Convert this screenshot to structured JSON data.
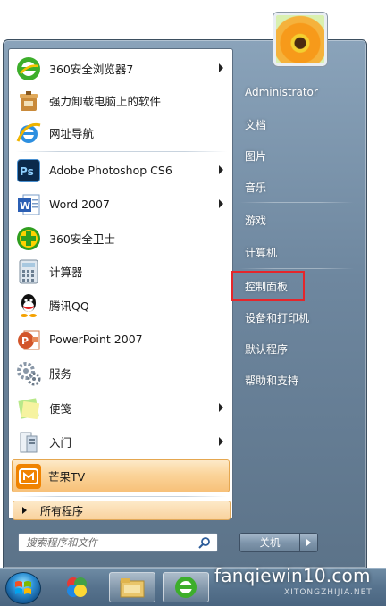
{
  "left_programs": [
    {
      "label": "360安全浏览器7",
      "icon": "360-browser-icon",
      "submenu": true
    },
    {
      "label": "强力卸载电脑上的软件",
      "icon": "uninstaller-icon",
      "submenu": false
    },
    {
      "label": "网址导航",
      "icon": "ie-nav-icon",
      "submenu": false
    },
    {
      "label": "Adobe Photoshop CS6",
      "icon": "photoshop-icon",
      "submenu": true
    },
    {
      "label": "Word 2007",
      "icon": "word-icon",
      "submenu": true
    },
    {
      "label": "360安全卫士",
      "icon": "360-safeguard-icon",
      "submenu": false
    },
    {
      "label": "计算器",
      "icon": "calculator-icon",
      "submenu": false
    },
    {
      "label": "腾讯QQ",
      "icon": "qq-icon",
      "submenu": false
    },
    {
      "label": "PowerPoint 2007",
      "icon": "powerpoint-icon",
      "submenu": false
    },
    {
      "label": "服务",
      "icon": "services-icon",
      "submenu": false
    },
    {
      "label": "便笺",
      "icon": "sticky-notes-icon",
      "submenu": true
    },
    {
      "label": "入门",
      "icon": "getting-started-icon",
      "submenu": true
    },
    {
      "label": "芒果TV",
      "icon": "mango-tv-icon",
      "submenu": false,
      "highlighted": true
    }
  ],
  "all_programs_label": "所有程序",
  "search": {
    "placeholder": "搜索程序和文件"
  },
  "right_links": {
    "user": "Administrator",
    "documents": "文档",
    "pictures": "图片",
    "music": "音乐",
    "games": "游戏",
    "computer": "计算机",
    "control_panel": "控制面板",
    "devices": "设备和打印机",
    "default_programs": "默认程序",
    "help": "帮助和支持"
  },
  "shutdown_label": "关机",
  "watermark": {
    "main": "fanqiewin10.com",
    "sub": "XITONGZHIJIA.NET"
  },
  "colors": {
    "highlight_border": "#e5262b",
    "menu_right": "#6e879f",
    "selected_item": "#fbd49a"
  }
}
